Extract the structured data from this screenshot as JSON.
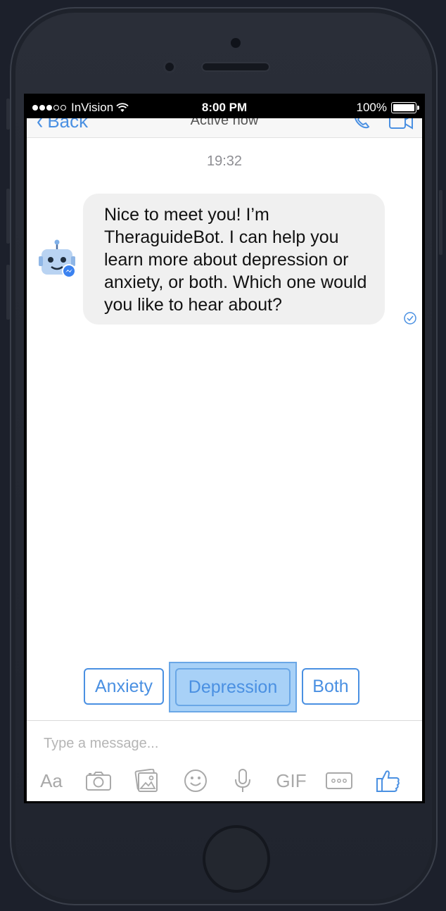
{
  "status_bar": {
    "carrier": "InVision",
    "time": "8:00 PM",
    "battery_percent": "100%"
  },
  "navbar": {
    "back_label": "Back",
    "subtitle": "Active now"
  },
  "chat": {
    "timestamp": "19:32",
    "bot_message": "Nice to meet you! I’m TheraguideBot. I can help you learn more about depression or anxiety, or both. Which one would you like to hear about?"
  },
  "quick_replies": {
    "anxiety": "Anxiety",
    "depression": "Depression",
    "both": "Both",
    "selected": "Depression"
  },
  "composer": {
    "placeholder": "Type a message...",
    "aa_label": "Aa",
    "gif_label": "GIF"
  },
  "colors": {
    "accent": "#4a90e2",
    "bubble": "#f0f0f0",
    "selected_fill": "#a8d1f7",
    "device": "#1c202b"
  },
  "icons": [
    "camera-icon",
    "gallery-icon",
    "smiley-icon",
    "microphone-icon",
    "more-icon",
    "thumbs-up-icon",
    "wifi-icon",
    "read-check-icon",
    "bot-avatar-icon"
  ]
}
